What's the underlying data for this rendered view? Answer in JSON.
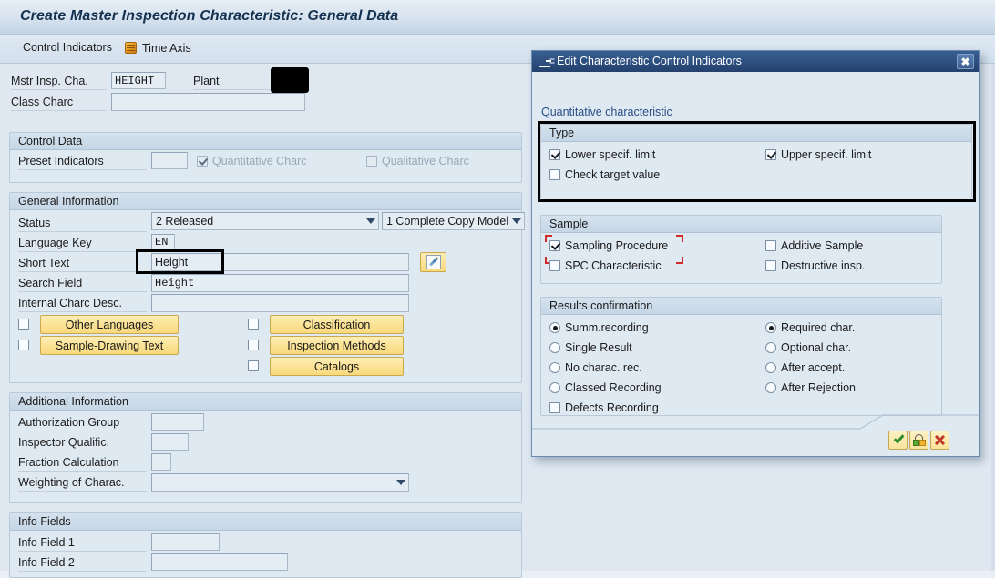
{
  "window": {
    "title": "Create Master Inspection Characteristic: General Data"
  },
  "toolbar": {
    "control_indicators_label": "Control Indicators",
    "time_axis_label": "Time Axis",
    "time_axis_icon": "scroll-icon"
  },
  "header_fields": {
    "mstr_insp_cha_label": "Mstr Insp. Cha.",
    "mstr_insp_cha_value": "HEIGHT",
    "plant_label": "Plant",
    "plant_value": "",
    "plant_redacted": true,
    "class_charc_label": "Class Charc",
    "class_charc_value": ""
  },
  "control_data": {
    "title": "Control Data",
    "preset_indicators_label": "Preset Indicators",
    "preset_indicators_value": "",
    "quantitative_charc_label": "Quantitative Charc",
    "quantitative_charc_checked": true,
    "quantitative_charc_disabled": true,
    "qualitative_charc_label": "Qualitative Charc",
    "qualitative_charc_checked": false,
    "qualitative_charc_disabled": true
  },
  "general_information": {
    "title": "General Information",
    "status_label": "Status",
    "status_value": "2 Released",
    "copy_model_value": "1 Complete Copy Model",
    "language_key_label": "Language Key",
    "language_key_value": "EN",
    "short_text_label": "Short Text",
    "short_text_value": "Height",
    "short_text_edit_icon": "pencil-icon",
    "search_field_label": "Search Field",
    "search_field_value": "Height",
    "internal_charc_desc_label": "Internal Charc Desc.",
    "internal_charc_desc_value": "",
    "buttons": [
      {
        "label": "Other Languages",
        "checked": false
      },
      {
        "label": "Sample-Drawing Text",
        "checked": false
      },
      {
        "label": "Classification",
        "checked": false
      },
      {
        "label": "Inspection Methods",
        "checked": false
      },
      {
        "label": "Catalogs",
        "checked": false
      }
    ]
  },
  "additional_information": {
    "title": "Additional Information",
    "authorization_group_label": "Authorization Group",
    "authorization_group_value": "",
    "inspector_qualific_label": "Inspector Qualific.",
    "inspector_qualific_value": "",
    "fraction_calculation_label": "Fraction Calculation",
    "fraction_calculation_value": "",
    "weighting_of_charac_label": "Weighting of Charac.",
    "weighting_of_charac_value": ""
  },
  "info_fields": {
    "title": "Info Fields",
    "info_field_1_label": "Info Field 1",
    "info_field_1_value": "",
    "info_field_2_label": "Info Field 2",
    "info_field_2_value": ""
  },
  "dialog": {
    "title": "Edit Characteristic Control Indicators",
    "title_icon": "dialog-window-icon",
    "close_label": "✖",
    "subtitle": "Quantitative characteristic",
    "type_group": {
      "title": "Type",
      "lower_specif_limit_label": "Lower specif. limit",
      "lower_specif_limit_checked": true,
      "upper_specif_limit_label": "Upper specif. limit",
      "upper_specif_limit_checked": true,
      "check_target_value_label": "Check target value",
      "check_target_value_checked": false
    },
    "sample_group": {
      "title": "Sample",
      "sampling_procedure_label": "Sampling Procedure",
      "sampling_procedure_checked": true,
      "sampling_procedure_focused": true,
      "additive_sample_label": "Additive Sample",
      "additive_sample_checked": false,
      "spc_characteristic_label": "SPC Characteristic",
      "spc_characteristic_checked": false,
      "destructive_insp_label": "Destructive insp.",
      "destructive_insp_checked": false
    },
    "results_group": {
      "title": "Results confirmation",
      "left_options": [
        {
          "label": "Summ.recording",
          "selected": true,
          "type": "radio"
        },
        {
          "label": "Single Result",
          "selected": false,
          "type": "radio"
        },
        {
          "label": "No charac. rec.",
          "selected": false,
          "type": "radio"
        },
        {
          "label": "Classed Recording",
          "selected": false,
          "type": "radio"
        },
        {
          "label": "Defects Recording",
          "selected": false,
          "type": "checkbox"
        }
      ],
      "right_options": [
        {
          "label": "Required char.",
          "selected": true,
          "type": "radio"
        },
        {
          "label": "Optional char.",
          "selected": false,
          "type": "radio"
        },
        {
          "label": "After accept.",
          "selected": false,
          "type": "radio"
        },
        {
          "label": "After Rejection",
          "selected": false,
          "type": "radio"
        }
      ]
    },
    "footer": {
      "confirm_icon": "green-check-icon",
      "transfer_icon": "copy-transfer-icon",
      "cancel_icon": "red-x-icon"
    }
  },
  "annotations": {
    "short_text_highlight": true,
    "type_group_highlight": true,
    "highlight_color": "#000000"
  }
}
